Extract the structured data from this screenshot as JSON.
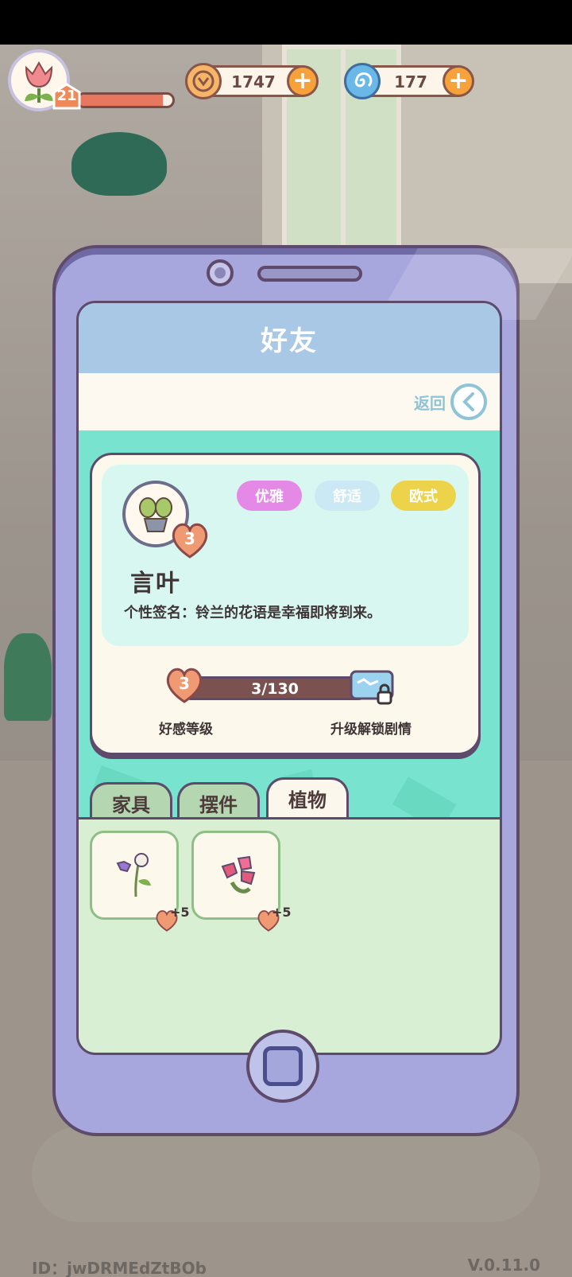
{
  "player": {
    "level": "21",
    "xp_fraction": 0.9
  },
  "currencies": [
    {
      "name": "coin",
      "value": "1747"
    },
    {
      "name": "gem",
      "value": "177"
    }
  ],
  "dialog": {
    "title": "好友",
    "back_label": "返回"
  },
  "friend": {
    "name": "言叶",
    "heart_level": "3",
    "tags": [
      {
        "label": "优雅",
        "color": "#e48ae6"
      },
      {
        "label": "舒适",
        "color": "#cbe9f4"
      },
      {
        "label": "欧式",
        "color": "#ecd34a"
      }
    ],
    "signature": "个性签名：铃兰的花语是幸福即将到来。",
    "affinity_level": "3",
    "affinity_progress": "3/130",
    "affinity_label": "好感等级",
    "unlock_label": "升级解锁剧情"
  },
  "tabs": [
    {
      "label": "家具",
      "active": false
    },
    {
      "label": "摆件",
      "active": false
    },
    {
      "label": "植物",
      "active": true
    }
  ],
  "items": [
    {
      "name": "purple-flower",
      "bonus": "+5"
    },
    {
      "name": "pink-lily",
      "bonus": "+5"
    }
  ],
  "footer": {
    "id": "ID：jwDRMEdZtBOb",
    "version": "V.0.11.0"
  }
}
